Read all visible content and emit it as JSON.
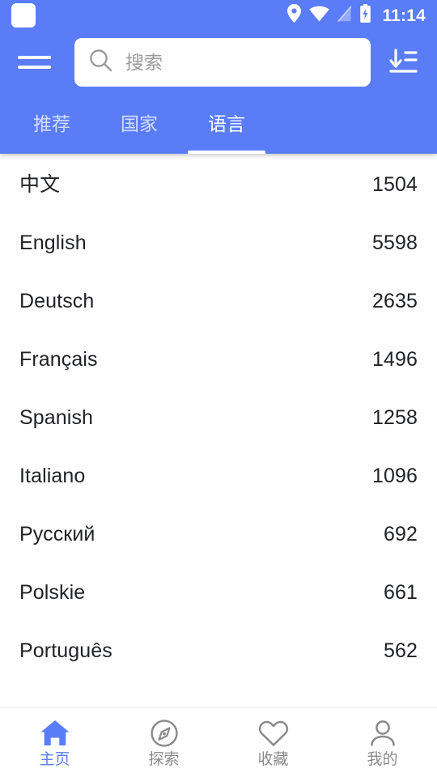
{
  "statusbar": {
    "app_icon": "app-square-icon",
    "icons": [
      "location-pin-icon",
      "wifi-icon",
      "no-signal-icon",
      "battery-charging-icon"
    ],
    "clock": "11:14"
  },
  "toolbar": {
    "menu_icon": "hamburger-menu-icon",
    "search": {
      "icon": "search-icon",
      "value": "",
      "placeholder": "搜索"
    },
    "sort_icon": "sort-descending-icon"
  },
  "tabs": {
    "items": [
      {
        "label": "推荐",
        "active": false
      },
      {
        "label": "国家",
        "active": false
      },
      {
        "label": "语言",
        "active": true
      }
    ],
    "active_index": 2
  },
  "list": {
    "rows": [
      {
        "label": "中文",
        "count": "1504"
      },
      {
        "label": "English",
        "count": "5598"
      },
      {
        "label": "Deutsch",
        "count": "2635"
      },
      {
        "label": "Français",
        "count": "1496"
      },
      {
        "label": "Spanish",
        "count": "1258"
      },
      {
        "label": "Italiano",
        "count": "1096"
      },
      {
        "label": "Русский",
        "count": "692"
      },
      {
        "label": "Polskie",
        "count": "661"
      },
      {
        "label": "Português",
        "count": "562"
      }
    ]
  },
  "bottomnav": {
    "items": [
      {
        "label": "主页",
        "icon": "home-icon",
        "active": true
      },
      {
        "label": "探索",
        "icon": "compass-icon",
        "active": false
      },
      {
        "label": "收藏",
        "icon": "heart-icon",
        "active": false
      },
      {
        "label": "我的",
        "icon": "person-icon",
        "active": false
      }
    ],
    "active_index": 0
  },
  "colors": {
    "accent": "#5a7df7",
    "appbar": "#5a7df7",
    "text": "#1f2124",
    "muted": "#8a8a8a",
    "surface": "#ffffff"
  }
}
